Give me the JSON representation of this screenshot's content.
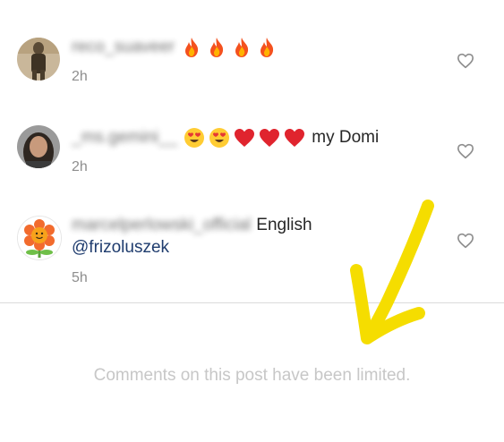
{
  "comments": [
    {
      "username": "reco_suaveer",
      "emojis": [
        "fire",
        "fire",
        "fire",
        "fire"
      ],
      "text": "",
      "time": "2h",
      "avatar": "person-photo"
    },
    {
      "username": "_ms.gemini__",
      "emojis": [
        "heart-eyes",
        "heart-eyes",
        "red-heart",
        "red-heart",
        "red-heart"
      ],
      "text": "my Domi",
      "time": "2h",
      "avatar": "woman-photo"
    },
    {
      "username": "marcelperlowski_official",
      "emojis": [],
      "text": "English",
      "mention": "@frizoluszek",
      "time": "5h",
      "avatar": "flower-illustration"
    }
  ],
  "footer": {
    "limited_text": "Comments on this post have been limited."
  },
  "colors": {
    "time": "#8e8e8e",
    "mention": "#1f3c6e",
    "annotation_arrow": "#f5dd00",
    "divider": "#dbdbdb"
  },
  "annotation": {
    "type": "hand-drawn-arrow",
    "direction": "down-left",
    "color": "#f5dd00"
  }
}
